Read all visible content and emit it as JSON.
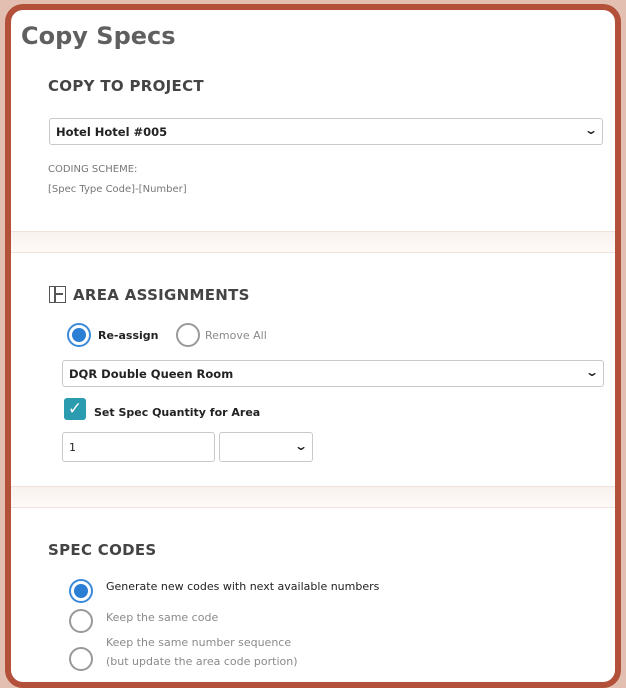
{
  "dialog": {
    "title": "Copy Specs"
  },
  "copy_to_project": {
    "heading": "COPY TO PROJECT",
    "selected_project": "Hotel Hotel #005",
    "coding_scheme_label": "CODING SCHEME:",
    "coding_scheme_value": "[Spec Type Code]-[Number]"
  },
  "area_assignments": {
    "heading": "AREA ASSIGNMENTS",
    "reassign_label": "Re-assign",
    "reassign_selected": true,
    "remove_all_label": "Remove All",
    "selected_area": "DQR Double Queen Room",
    "set_quantity_label": "Set Spec Quantity for Area",
    "set_quantity_checked": true,
    "quantity_value": "1",
    "unit_value": ""
  },
  "spec_codes": {
    "heading": "SPEC CODES",
    "options": [
      {
        "label": "Generate new codes with next available numbers",
        "selected": true
      },
      {
        "label": "Keep the same code",
        "selected": false
      },
      {
        "label": "Keep the same number sequence",
        "sublabel": "(but update the area code portion)",
        "selected": false
      }
    ]
  },
  "icons": {
    "chevron": "chevron-down-icon",
    "area": "area-layout-icon",
    "check": "check-icon"
  },
  "colors": {
    "frame": "#b3503a",
    "radio_accent": "#2a7fd4",
    "checkbox": "#2b9bb0"
  }
}
